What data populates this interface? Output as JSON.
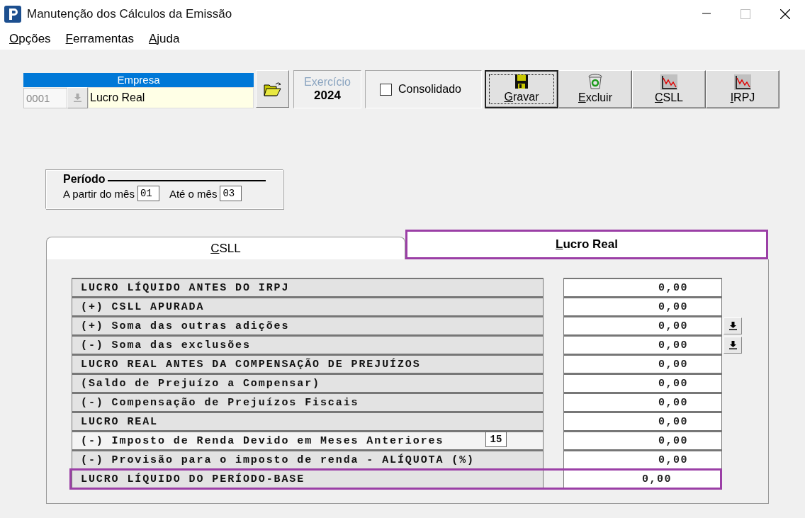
{
  "window": {
    "title": "Manutenção dos Cálculos da Emissão"
  },
  "menu": [
    {
      "label": "Opções"
    },
    {
      "label": "Ferramentas"
    },
    {
      "label": "Ajuda"
    }
  ],
  "empresa": {
    "heading": "Empresa",
    "code": "0001",
    "name": "Lucro Real"
  },
  "exercicio": {
    "label": "Exercício",
    "value": "2024"
  },
  "consolidado": {
    "label": "Consolidado",
    "checked": false
  },
  "toolbar": [
    {
      "label": "Gravar",
      "kind": "save",
      "focused": true
    },
    {
      "label": "Excluir",
      "kind": "delete",
      "focused": false
    },
    {
      "label": "CSLL",
      "kind": "chart",
      "focused": false
    },
    {
      "label": "IRPJ",
      "kind": "chart",
      "focused": false
    }
  ],
  "periodo": {
    "title": "Período",
    "from_label": "A partir do mês",
    "from": "01",
    "to_label": "Até o mês",
    "to": "03"
  },
  "tabs": [
    {
      "label": "CSLL",
      "selected": false,
      "highlighted": false
    },
    {
      "label": "Lucro Real",
      "selected": true,
      "highlighted": true
    }
  ],
  "rows": [
    {
      "label": "LUCRO LÍQUIDO ANTES DO IRPJ",
      "value": "0,00",
      "kind": "plain",
      "highlighted": false
    },
    {
      "label": "(+) CSLL APURADA",
      "value": "0,00",
      "kind": "plain",
      "highlighted": false
    },
    {
      "label": "(+) Soma das outras adições",
      "value": "0,00",
      "kind": "lookup",
      "highlighted": false
    },
    {
      "label": "(-) Soma das exclusões",
      "value": "0,00",
      "kind": "lookup",
      "highlighted": false
    },
    {
      "label": "LUCRO REAL ANTES DA COMPENSAÇÃO DE PREJUÍZOS",
      "value": "0,00",
      "kind": "plain",
      "highlighted": false
    },
    {
      "label": "(Saldo de Prejuízo a Compensar)",
      "value": "0,00",
      "kind": "plain",
      "highlighted": false
    },
    {
      "label": "(-) Compensação de Prejuízos Fiscais",
      "value": "0,00",
      "kind": "plain",
      "highlighted": false
    },
    {
      "label": "LUCRO REAL",
      "value": "0,00",
      "kind": "plain",
      "highlighted": false
    },
    {
      "label": "(-) Imposto de Renda Devido em Meses Anteriores",
      "value": "0,00",
      "kind": "rate",
      "rate": "15",
      "highlighted": false
    },
    {
      "label": "(-) Provisão para o imposto de renda - ALÍQUOTA (%)",
      "value": "0,00",
      "kind": "plain",
      "highlighted": false
    },
    {
      "label": "LUCRO LÍQUIDO DO PERÍODO-BASE",
      "value": "0,00",
      "kind": "plain",
      "highlighted": true
    }
  ]
}
